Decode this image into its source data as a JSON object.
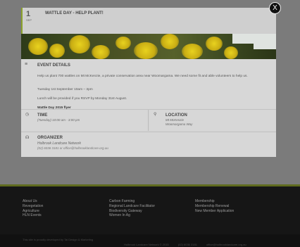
{
  "modal": {
    "date_day": "1",
    "date_month": "SEP",
    "title": "WATTLE DAY - HELP PLANT!",
    "close_label": "X",
    "details": {
      "label": "EVENT DETAILS",
      "p1": "Help us plant 700 wattles on Mt McKenzie, a private conservation area near Woomargama. We need some fit and able volunteers to help us.",
      "p2": "Tuesday 1st September 10am – 3pm",
      "p3": "Lunch will be provided if you RSVP by Monday 31st August.",
      "p4": "Wattle Day 2015 flyer"
    },
    "time": {
      "label": "TIME",
      "value": "(Tuesday) 10:00 am - 3:00 pm"
    },
    "location": {
      "label": "LOCATION",
      "line1": "Mt McKenzie",
      "line2": "Woomargama Way"
    },
    "organizer": {
      "label": "ORGANIZER",
      "name": "Holbrook Landcare Network",
      "contact": "(02) 6036 3181 or office@holbrooklandcare.org.au"
    }
  },
  "footer": {
    "col1": [
      "About Us",
      "Revegetation",
      "Agriculture",
      "HLN Events"
    ],
    "col2": [
      "Carbon Farming",
      "Regional Landcare Facilitator",
      "Biodiversity Gateway",
      "Women In Ag"
    ],
    "col3": [
      "Membership",
      "Membership Renewal",
      "New Member Application"
    ],
    "credit": "This site is proudly developed by Tai Design & Marketing",
    "contact_items": [
      "Holbrook Landcare Network © 2015",
      "(02) 6036 3181",
      "office@holbrooklandcare.org.au"
    ]
  }
}
